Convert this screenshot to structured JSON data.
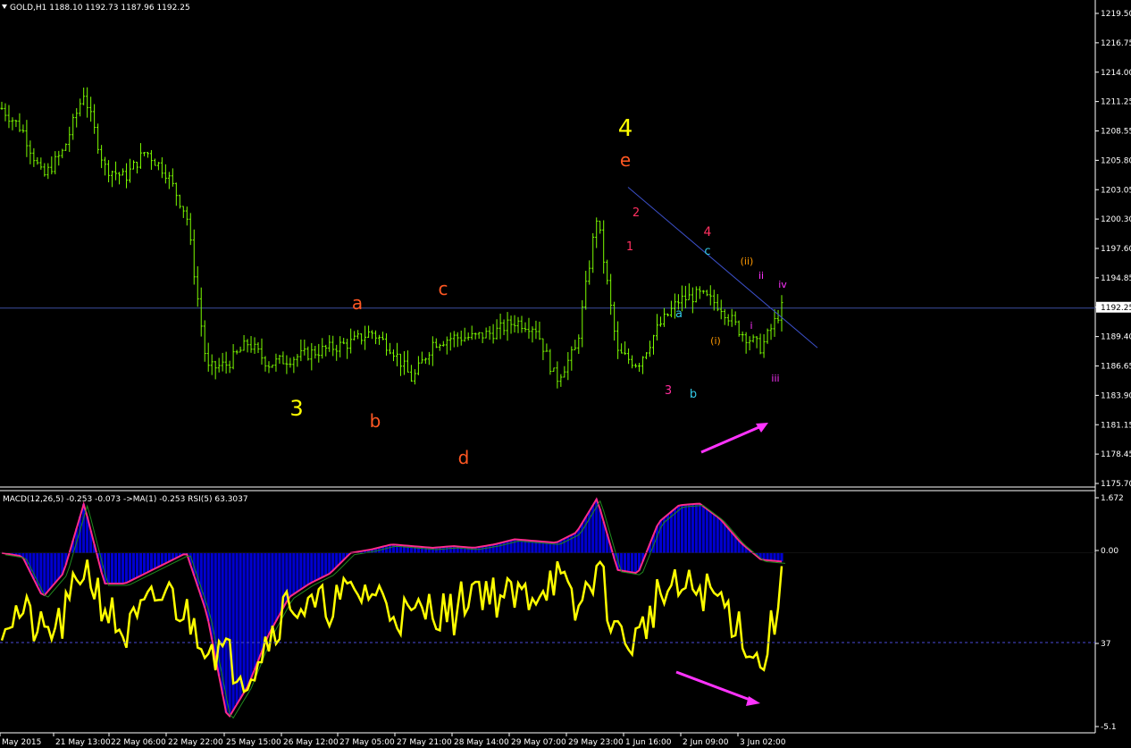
{
  "window": {
    "symbol_header": "GOLD,H1",
    "ohlc": [
      "1188.10",
      "1192.73",
      "1187.96",
      "1192.25"
    ],
    "indicator_header": "MACD(12,26,5) -0.253 -0.073  ->MA(1) -0.253  RSI(5) 63.3037"
  },
  "colors": {
    "background": "#000000",
    "candle": "#7CFC00",
    "price_line": "#3d4f9f",
    "trendline": "#3b4fc7",
    "macd_hist": "#0000d0",
    "macd_signal": "#ff2a8a",
    "rsi_line": "#ffff00",
    "ma_line": "#1f8a1f",
    "arrow": "#ff33ff",
    "axis_text": "#ffffff"
  },
  "price_axis": {
    "ticks": [
      "1219.50",
      "1216.75",
      "1214.00",
      "1211.25",
      "1208.55",
      "1205.80",
      "1203.05",
      "1200.30",
      "1197.60",
      "1194.85",
      "1192.25",
      "1189.40",
      "1186.65",
      "1183.90",
      "1181.15",
      "1178.45",
      "1175.70"
    ],
    "current_price_label": "1192.25"
  },
  "indicator_axis": {
    "ticks": [
      "1.672",
      "0.00",
      "37",
      "-5.1"
    ]
  },
  "time_axis": {
    "ticks": [
      "May 2015",
      "21 May 13:00",
      "22 May 06:00",
      "22 May 22:00",
      "25 May 15:00",
      "26 May 12:00",
      "27 May 05:00",
      "27 May 21:00",
      "28 May 14:00",
      "29 May 07:00",
      "29 May 23:00",
      "1 Jun 16:00",
      "2 Jun 09:00",
      "3 Jun 02:00"
    ]
  },
  "wave_labels": [
    {
      "text": "4",
      "color": "#ffff00",
      "size": 26
    },
    {
      "text": "e",
      "color": "#ff5722",
      "size": 20
    },
    {
      "text": "3",
      "color": "#ffff00",
      "size": 24
    },
    {
      "text": "a",
      "color": "#ff5722",
      "size": 20
    },
    {
      "text": "b",
      "color": "#ff5722",
      "size": 20
    },
    {
      "text": "c",
      "color": "#ff5722",
      "size": 20
    },
    {
      "text": "d",
      "color": "#ff5722",
      "size": 20
    },
    {
      "text": "2",
      "color": "#ff3060",
      "size": 13
    },
    {
      "text": "1",
      "color": "#ff3060",
      "size": 13
    },
    {
      "text": "3",
      "color": "#ff2d9b",
      "size": 13
    },
    {
      "text": "4",
      "color": "#ff3060",
      "size": 14
    },
    {
      "text": "a",
      "color": "#33c9e6",
      "size": 13
    },
    {
      "text": "b",
      "color": "#33c9e6",
      "size": 13
    },
    {
      "text": "c",
      "color": "#33c9e6",
      "size": 13
    },
    {
      "text": "(i)",
      "color": "#ff9900",
      "size": 11
    },
    {
      "text": "(ii)",
      "color": "#ff9900",
      "size": 11
    },
    {
      "text": "i",
      "color": "#ff33ff",
      "size": 11
    },
    {
      "text": "ii",
      "color": "#ff33ff",
      "size": 11
    },
    {
      "text": "iii",
      "color": "#ff33ff",
      "size": 11
    },
    {
      "text": "iv",
      "color": "#ff33ff",
      "size": 11
    }
  ],
  "chart_data": [
    {
      "type": "line",
      "title": "GOLD,H1",
      "chart_style": "candlestick",
      "ylim": [
        1175.7,
        1220.0
      ],
      "current_price": 1192.25,
      "x": [
        "May 2015",
        "21 May 13:00",
        "22 May 06:00",
        "22 May 22:00",
        "25 May 15:00",
        "26 May 12:00",
        "27 May 05:00",
        "27 May 21:00",
        "28 May 14:00",
        "29 May 07:00",
        "29 May 23:00",
        "1 Jun 16:00",
        "2 Jun 09:00",
        "3 Jun 02:00"
      ],
      "series": [
        {
          "values": [
            1211.0,
            1209.0,
            1204.5,
            1207.0,
            1212.5,
            1205.5,
            1204.5,
            1207.0,
            1205.0,
            1201.0,
            1186.5,
            1187.0,
            1189.0,
            1187.0,
            1187.5,
            1188.0,
            1188.5,
            1189.0,
            1190.0,
            1188.5,
            1185.5,
            1189.0,
            1189.5,
            1189.5,
            1190.0,
            1191.0,
            1190.5,
            1185.5,
            1188.5,
            1201.0,
            1188.0,
            1187.0,
            1190.5,
            1193.0,
            1193.5,
            1192.5,
            1190.0,
            1188.5,
            1192.25
          ]
        }
      ],
      "trendline": {
        "from": [
          "1 Jun 16:00",
          1203.6
        ],
        "to": [
          "3 Jun 02:00",
          1191.3
        ]
      }
    },
    {
      "type": "line",
      "title": "MACD(12,26,5) -0.253 -0.073  ->MA(1) -0.253  RSI(5) 63.3037",
      "ylim": [
        -5.1,
        1.672
      ],
      "series": [
        {
          "name": "MACD(12,26,5)",
          "values": [
            0.0,
            -0.1,
            -1.3,
            -0.6,
            1.45,
            -0.9,
            -0.9,
            -0.6,
            -0.3,
            -0.0,
            -1.8,
            -4.9,
            -3.9,
            -2.4,
            -1.3,
            -0.9,
            -0.6,
            0.0,
            0.1,
            0.25,
            0.2,
            0.15,
            0.2,
            0.15,
            0.25,
            0.4,
            0.35,
            0.3,
            0.6,
            1.6,
            -0.5,
            -0.6,
            0.9,
            1.4,
            1.45,
            1.0,
            0.3,
            -0.2,
            -0.253
          ]
        },
        {
          "name": "RSI(5)",
          "values": [
            48,
            52,
            40,
            47,
            75,
            55,
            40,
            52,
            62,
            50,
            38,
            30,
            22,
            40,
            58,
            52,
            56,
            60,
            62,
            54,
            48,
            55,
            50,
            66,
            60,
            58,
            62,
            70,
            50,
            75,
            40,
            38,
            60,
            62,
            63,
            58,
            44,
            24,
            63.3037
          ]
        }
      ]
    }
  ]
}
